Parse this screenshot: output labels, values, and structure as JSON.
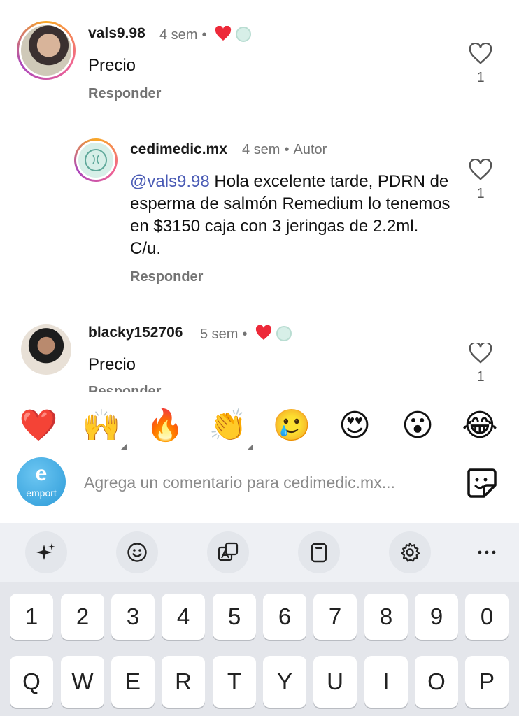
{
  "comments": [
    {
      "username": "vals9.98",
      "time": "4 sem",
      "text": "Precio",
      "reply": "Responder",
      "likes": "1",
      "liked_by_author": true
    },
    {
      "username": "cedimedic.mx",
      "time": "4 sem",
      "author_badge": "Autor",
      "mention": "@vals9.98",
      "text": " Hola excelente tarde, PDRN de esperma de salmón Remedium lo tenemos en $3150 caja con 3 jeringas de 2.2ml. C/u.",
      "reply": "Responder",
      "likes": "1"
    },
    {
      "username": "blacky152706",
      "time": "5 sem",
      "text": "Precio",
      "reply": "Responder",
      "likes": "1",
      "liked_by_author": true
    }
  ],
  "emoji_bar": [
    "❤️",
    "🙌",
    "🔥",
    "👏",
    "🥲",
    "😍",
    "😮",
    "😂"
  ],
  "comment_box": {
    "avatar_text": "e",
    "avatar_subtext": "emport",
    "placeholder": "Agrega un comentario para cedimedic.mx..."
  },
  "keyboard": {
    "toolbar": [
      "sparkle-icon",
      "emoji-icon",
      "translate-icon",
      "clipboard-icon",
      "settings-icon",
      "more-icon"
    ],
    "number_row": [
      "1",
      "2",
      "3",
      "4",
      "5",
      "6",
      "7",
      "8",
      "9",
      "0"
    ],
    "letter_row": [
      "Q",
      "W",
      "E",
      "R",
      "T",
      "Y",
      "U",
      "I",
      "O",
      "P"
    ]
  },
  "colors": {
    "like_red": "#ed2939",
    "mention": "#4a5bb5",
    "meta_gray": "#737373"
  }
}
